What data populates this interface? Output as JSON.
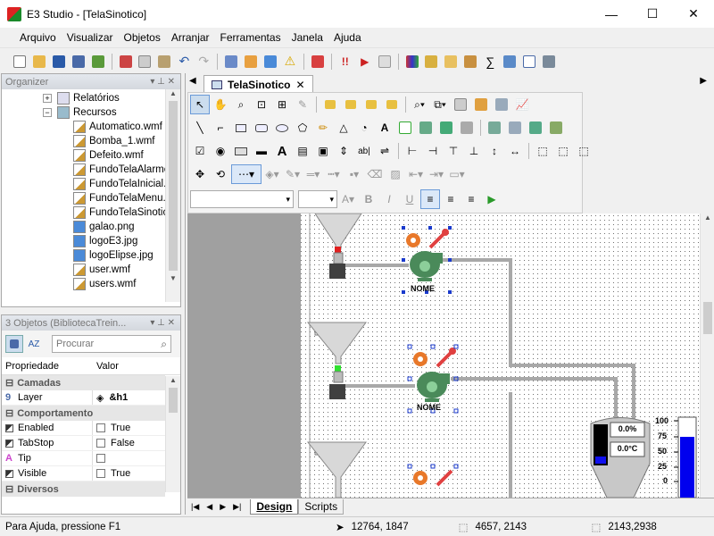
{
  "window": {
    "title": "E3 Studio - [TelaSinotico]",
    "minimize": "—",
    "maximize": "☐",
    "close": "✕"
  },
  "menu": [
    "Arquivo",
    "Visualizar",
    "Objetos",
    "Arranjar",
    "Ferramentas",
    "Janela",
    "Ajuda"
  ],
  "organizer": {
    "title": "Organizer",
    "items": [
      {
        "label": "Relatórios",
        "expander": "+",
        "icon": "reports-icon"
      },
      {
        "label": "Recursos",
        "expander": "−",
        "icon": "resources-icon"
      },
      {
        "label": "Automatico.wmf",
        "icon": "wmf-file-icon"
      },
      {
        "label": "Bomba_1.wmf",
        "icon": "wmf-file-icon"
      },
      {
        "label": "Defeito.wmf",
        "icon": "wmf-file-icon"
      },
      {
        "label": "FundoTelaAlarme",
        "icon": "wmf-file-icon"
      },
      {
        "label": "FundoTelaInicial.",
        "icon": "wmf-file-icon"
      },
      {
        "label": "FundoTelaMenu.",
        "icon": "wmf-file-icon"
      },
      {
        "label": "FundoTelaSinotic",
        "icon": "wmf-file-icon"
      },
      {
        "label": "galao.png",
        "icon": "image-file-icon"
      },
      {
        "label": "logoE3.jpg",
        "icon": "image-file-icon"
      },
      {
        "label": "logoElipse.jpg",
        "icon": "image-file-icon"
      },
      {
        "label": "user.wmf",
        "icon": "wmf-file-icon"
      },
      {
        "label": "users.wmf",
        "icon": "wmf-file-icon"
      }
    ]
  },
  "properties": {
    "title": "3 Objetos (BibliotecaTrein...",
    "search_placeholder": "Procurar",
    "col_name": "Propriedade",
    "col_value": "Valor",
    "groups": [
      {
        "name": "Camadas",
        "rows": [
          {
            "name": "Layer",
            "value": "&h1"
          }
        ]
      },
      {
        "name": "Comportamento",
        "rows": [
          {
            "name": "Enabled",
            "value": "True"
          },
          {
            "name": "TabStop",
            "value": "False"
          },
          {
            "name": "Tip",
            "value": ""
          },
          {
            "name": "Visible",
            "value": "True"
          }
        ]
      },
      {
        "name": "Diversos",
        "rows": []
      }
    ]
  },
  "document": {
    "tab": "TelaSinotico",
    "pumps": [
      {
        "label": "NOME"
      },
      {
        "label": "NOME"
      }
    ],
    "tank": {
      "level_display": "0.0%",
      "temp_display": "0.0°C",
      "scale": [
        "100",
        "75",
        "50",
        "25",
        "0"
      ]
    },
    "bottom_tabs": [
      "Design",
      "Scripts"
    ]
  },
  "status": {
    "help": "Para Ajuda, pressione F1",
    "cursor": "12764, 1847",
    "position": "4657, 2143",
    "size": "2143,2938"
  },
  "colors": {
    "accent": "#3366cc",
    "pump_green": "#4a8a5a",
    "gear": "#e8782a",
    "wrench": "#e04040",
    "bar_blue": "#0000ee"
  }
}
